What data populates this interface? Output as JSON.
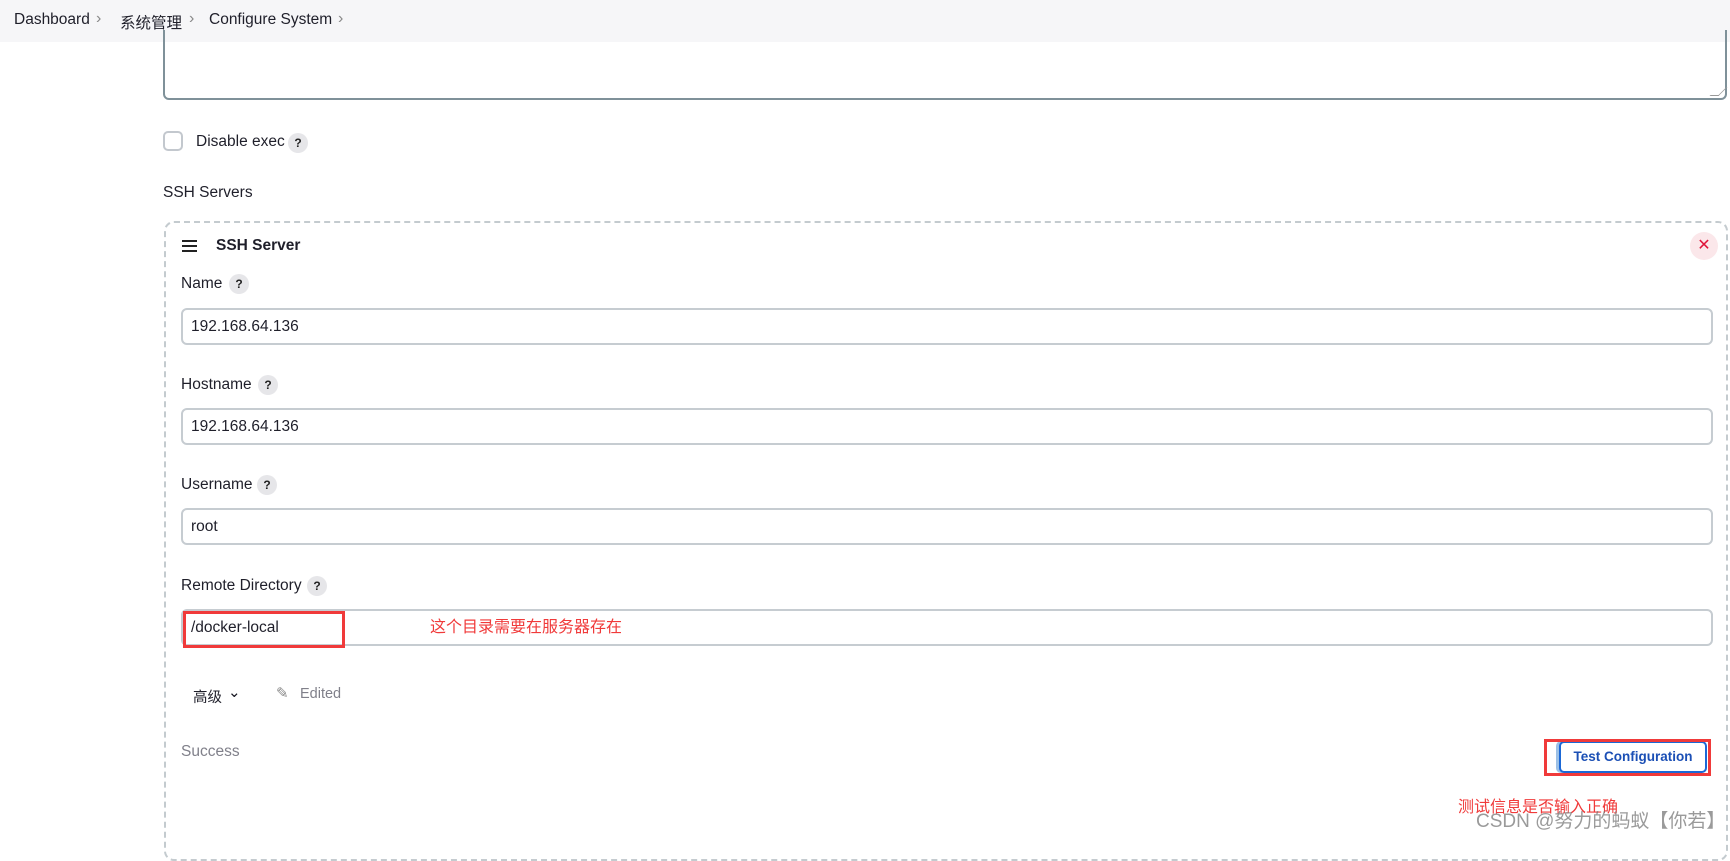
{
  "breadcrumb": {
    "items": [
      "Dashboard",
      "系统管理",
      "Configure System"
    ]
  },
  "disable_exec": {
    "label": "Disable exec",
    "checked": false
  },
  "ssh_servers": {
    "section_label": "SSH Servers",
    "server": {
      "title": "SSH Server",
      "fields": {
        "name": {
          "label": "Name",
          "value": "192.168.64.136"
        },
        "hostname": {
          "label": "Hostname",
          "value": "192.168.64.136"
        },
        "username": {
          "label": "Username",
          "value": "root"
        },
        "remote_directory": {
          "label": "Remote Directory",
          "value": "/docker-local"
        }
      },
      "advanced_label": "高级",
      "edited_label": "Edited",
      "status": "Success",
      "test_button": "Test Configuration"
    }
  },
  "annotations": {
    "remote_dir_note": "这个目录需要在服务器存在",
    "test_note": "测试信息是否输入正确"
  },
  "watermark": "CSDN @努力的蚂蚁【你若】",
  "colors": {
    "accent": "#1b68d6",
    "annotation": "#f03a3a",
    "danger": "#e0153a"
  }
}
